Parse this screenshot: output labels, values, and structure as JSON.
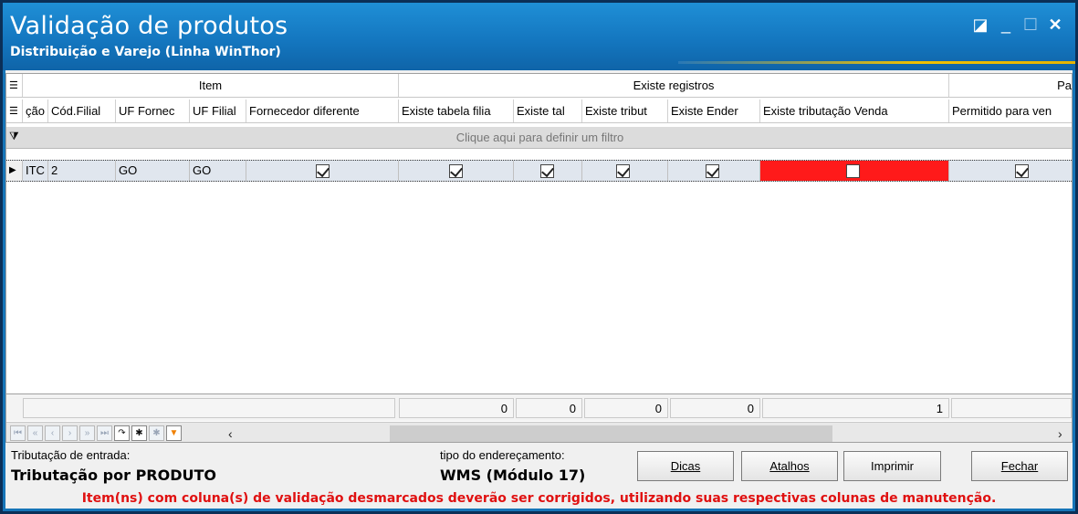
{
  "window": {
    "title": "Validação de produtos",
    "subtitle": "Distribuição e Varejo (Linha WinThor)",
    "controls": [
      "◪",
      "_",
      "☐",
      "✕"
    ]
  },
  "grid": {
    "group_headers": {
      "item": "Item",
      "existe": "Existe registros",
      "pa": "Pa"
    },
    "columns": [
      "ção",
      "Cód.Filial",
      "UF Fornec",
      "UF Filial",
      "Fornecedor diferente",
      "Existe tabela filia",
      "Existe tal",
      "Existe tribut",
      "Existe Ender",
      "Existe tributação Venda",
      "Permitido para ven"
    ],
    "filter_text": "Clique aqui para definir um filtro",
    "rows": [
      {
        "col0": "ITC",
        "cod_filial": "2",
        "uf_fornec": "GO",
        "uf_filial": "GO",
        "checks": [
          true,
          true,
          true,
          true,
          true,
          false,
          true
        ]
      }
    ],
    "footer_totals": [
      "0",
      "0",
      "0",
      "0",
      "1"
    ]
  },
  "colors": {
    "title_bar": "#1477c0",
    "invalid_cell": "#ff1a1a",
    "warning_text": "#e01010"
  },
  "bottom": {
    "trib_label": "Tributação de entrada:",
    "trib_value": "Tributação por PRODUTO",
    "end_label": "tipo do endereçamento:",
    "end_value": "WMS (Módulo 17)"
  },
  "buttons": {
    "dicas": "Dicas",
    "atalhos": "Atalhos",
    "imprimir": "Imprimir",
    "fechar": "Fechar"
  },
  "warning": "Item(ns) com coluna(s) de validação desmarcados deverão ser corrigidos, utilizando suas respectivas colunas de manutenção."
}
